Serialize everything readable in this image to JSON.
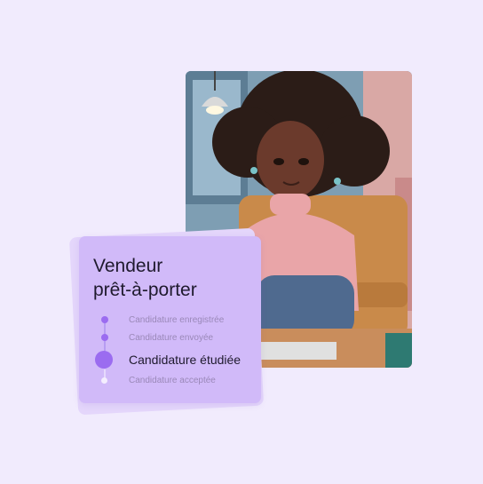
{
  "card": {
    "title_line1": "Vendeur",
    "title_line2": "prêt-à-porter"
  },
  "steps": [
    {
      "label": "Candidature enregistrée",
      "state": "done"
    },
    {
      "label": "Candidature envoyée",
      "state": "done"
    },
    {
      "label": "Candidature étudiée",
      "state": "current"
    },
    {
      "label": "Candidature acceptée",
      "state": "upcoming"
    }
  ],
  "colors": {
    "background": "#f1ebfd",
    "card": "#d1baf9",
    "accent": "#9b6cf0"
  }
}
